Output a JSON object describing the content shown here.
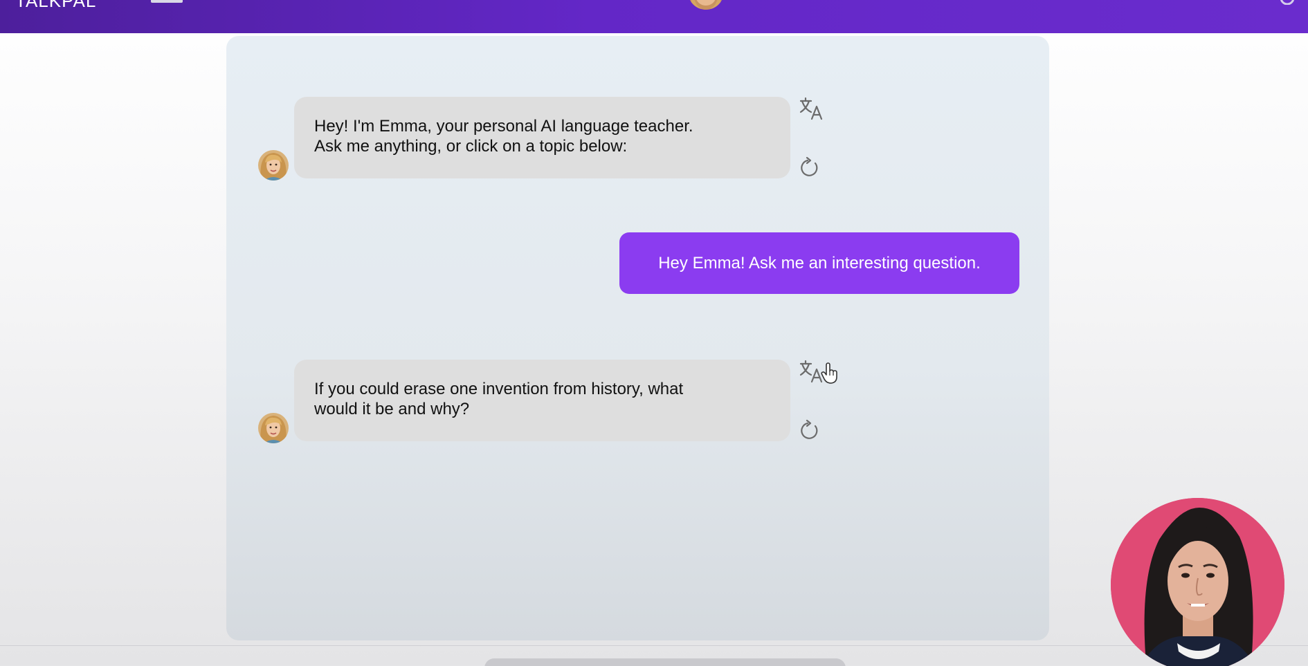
{
  "topbar": {
    "logo_text": "TALKPAL",
    "accent_color": "#6327c7"
  },
  "messages": [
    {
      "role": "assistant",
      "lines": [
        "Hey! I'm Emma, your personal AI language teacher.",
        "Ask me anything, or click on a topic below:"
      ],
      "actions": [
        "translate-icon",
        "regenerate-icon"
      ]
    },
    {
      "role": "user",
      "text": "Hey Emma! Ask me an interesting question."
    },
    {
      "role": "assistant",
      "lines": [
        "If you could erase one invention from history, what",
        "would it be and why?"
      ],
      "actions": [
        "translate-icon",
        "regenerate-icon"
      ]
    }
  ],
  "colors": {
    "user_bubble": "#8b3cf0",
    "bot_bubble": "#dedede",
    "presenter_bg": "#e04a74"
  }
}
